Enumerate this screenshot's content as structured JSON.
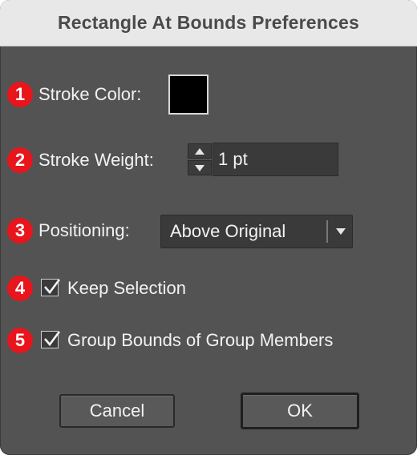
{
  "window": {
    "title": "Rectangle At Bounds Preferences"
  },
  "stroke_color": {
    "badge": "1",
    "label": "Stroke Color:",
    "value": "#000000"
  },
  "stroke_weight": {
    "badge": "2",
    "label": "Stroke Weight:",
    "value": "1 pt"
  },
  "positioning": {
    "badge": "3",
    "label": "Positioning:",
    "selected": "Above Original"
  },
  "keep_selection": {
    "badge": "4",
    "label": "Keep Selection",
    "checked": true
  },
  "group_bounds": {
    "badge": "5",
    "label": "Group Bounds of Group Members",
    "checked": true
  },
  "buttons": {
    "cancel": "Cancel",
    "ok": "OK"
  },
  "colors": {
    "badge": "#e8151d",
    "dialog_bg": "#535353",
    "titlebar_bg": "#e8e8e8"
  }
}
